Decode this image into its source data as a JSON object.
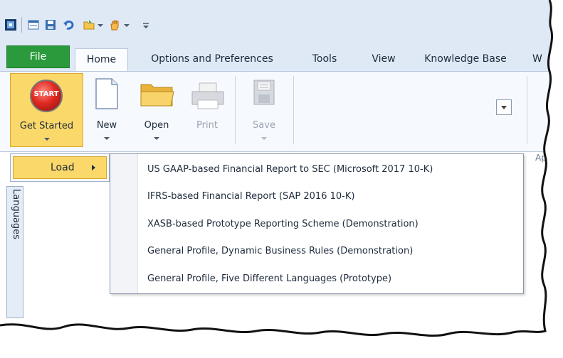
{
  "tabs": {
    "file": "File",
    "home": "Home",
    "options": "Options and Preferences",
    "tools": "Tools",
    "view": "View",
    "kb": "Knowledge Base",
    "partial": "W"
  },
  "ribbon": {
    "get_started": "Get Started",
    "start_badge": "START",
    "new": "New",
    "open": "Open",
    "print": "Print",
    "save": "Save",
    "partial_group": "Ap"
  },
  "load_menu": {
    "label": "Load"
  },
  "dropdown": {
    "items": [
      "US GAAP-based Financial Report to SEC (Microsoft 2017 10-K)",
      "IFRS-based Financial Report (SAP 2016 10-K)",
      "XASB-based Prototype Reporting Scheme (Demonstration)",
      "General Profile, Dynamic Business Rules (Demonstration)",
      "General Profile, Five Different Languages (Prototype)"
    ]
  },
  "side_panel": {
    "label": "Languages"
  },
  "icons": [
    "app-icon",
    "layout-icon",
    "save-icon",
    "undo-icon",
    "open-icon",
    "hand-icon",
    "customize-icon",
    "new-document-icon",
    "folder-icon",
    "printer-icon",
    "floppy-icon",
    "dialog-launcher-icon"
  ],
  "colors": {
    "file_tab": "#2a9a3c",
    "highlight": "#fbd86a",
    "ribbon_bg": "#f6f9fd",
    "tab_bar": "#dfe9f5"
  }
}
